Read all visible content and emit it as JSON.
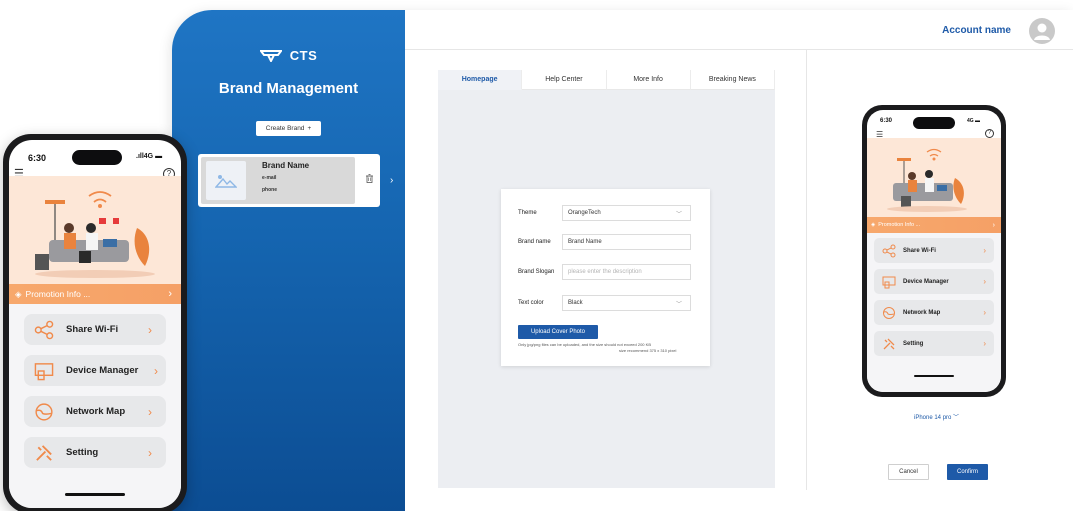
{
  "sidebar": {
    "logo_text": "CTS",
    "title": "Brand Management",
    "create_brand_label": "Create Brand",
    "create_brand_icon": "+",
    "brand_card": {
      "name": "Brand Name",
      "email": "e-mail",
      "phone": "phone"
    }
  },
  "header": {
    "account_name": "Account name"
  },
  "tabs": [
    {
      "label": "Homepage",
      "active": true
    },
    {
      "label": "Help Center",
      "active": false
    },
    {
      "label": "More Info",
      "active": false
    },
    {
      "label": "Breaking News",
      "active": false
    }
  ],
  "form": {
    "theme_label": "Theme",
    "theme_value": "OrangeTech",
    "brand_name_label": "Brand name",
    "brand_name_value": "Brand Name",
    "brand_slogan_label": "Brand Slogan",
    "brand_slogan_placeholder": "please enter the description",
    "text_color_label": "Text color",
    "text_color_value": "Black",
    "upload_label": "Upload Cover Photo",
    "upload_note_1": "Only jpg/png files can be uploaded, and the size should not exceed 200 KB",
    "upload_note_2": "size recommend 375 x 310 pixel"
  },
  "phone": {
    "time": "6:30",
    "network": "4G",
    "promo_text": "Promotion Info ...",
    "menu": [
      {
        "label": "Share Wi-Fi",
        "icon": "share-icon"
      },
      {
        "label": "Device Manager",
        "icon": "device-manager-icon"
      },
      {
        "label": "Network Map",
        "icon": "network-map-icon"
      },
      {
        "label": "Setting",
        "icon": "setting-icon"
      }
    ]
  },
  "preview": {
    "device_select": "iPhone 14 pro",
    "cancel_label": "Cancel",
    "confirm_label": "Confirm"
  },
  "colors": {
    "primary": "#1e5aa8",
    "sidebar": "#1565b0",
    "promo": "#f5a066",
    "hero": "#fde7d7"
  }
}
